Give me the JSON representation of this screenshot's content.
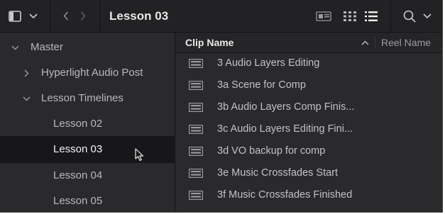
{
  "toolbar": {
    "title": "Lesson 03"
  },
  "tree": {
    "items": [
      {
        "label": "Master",
        "state": "expanded"
      },
      {
        "label": "Hyperlight Audio Post",
        "state": "collapsed"
      },
      {
        "label": "Lesson Timelines",
        "state": "expanded"
      },
      {
        "label": "Lesson 02"
      },
      {
        "label": "Lesson 03",
        "selected": true
      },
      {
        "label": "Lesson 04"
      },
      {
        "label": "Lesson 05"
      }
    ]
  },
  "list": {
    "columns": [
      "Clip Name",
      "Reel Name"
    ],
    "sort": "ascending",
    "rows": [
      "3 Audio Layers Editing",
      "3a Scene for Comp",
      "3b Audio Layers Comp Finis...",
      "3c Audio Layers Editing Fini...",
      "3d VO backup for comp",
      "3e Music Crossfades Start",
      "3f Music Crossfades Finished"
    ]
  },
  "colors": {
    "panel_bg": "#2a2a2c",
    "toolbar_bg": "#222224",
    "selected_bg": "#17171a",
    "text": "#c2c2c4"
  }
}
